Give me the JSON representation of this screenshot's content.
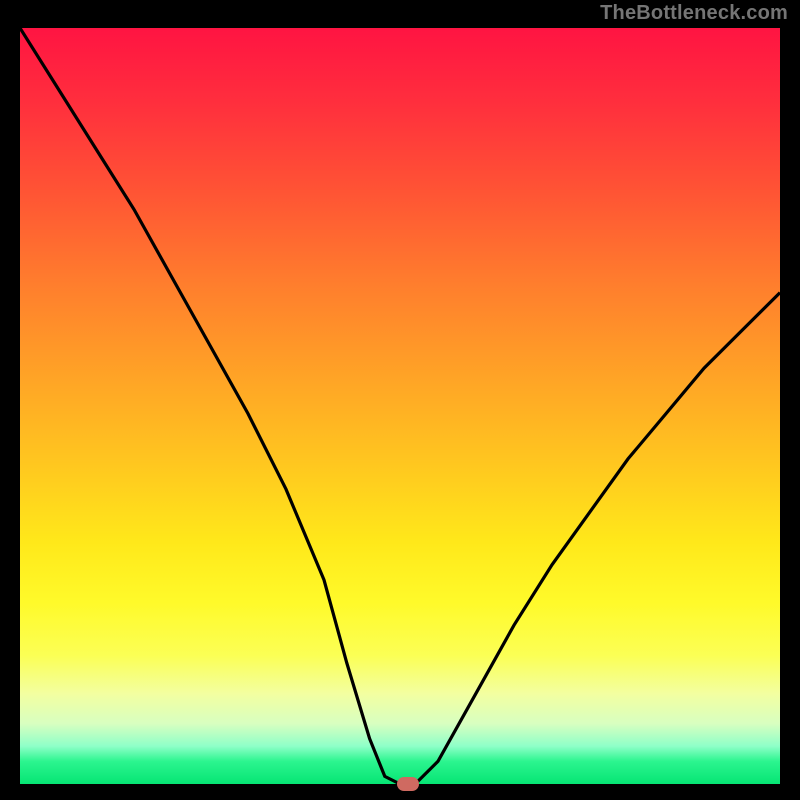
{
  "watermark": "TheBottleneck.com",
  "chart_data": {
    "type": "line",
    "title": "",
    "xlabel": "",
    "ylabel": "",
    "xlim": [
      0,
      100
    ],
    "ylim": [
      0,
      100
    ],
    "x": [
      0,
      5,
      10,
      15,
      20,
      25,
      30,
      35,
      40,
      43,
      46,
      48,
      50,
      52,
      55,
      60,
      65,
      70,
      75,
      80,
      85,
      90,
      95,
      100
    ],
    "values": [
      100,
      92,
      84,
      76,
      67,
      58,
      49,
      39,
      27,
      16,
      6,
      1,
      0,
      0,
      3,
      12,
      21,
      29,
      36,
      43,
      49,
      55,
      60,
      65
    ],
    "marker": {
      "x": 51,
      "y": 0
    },
    "background_gradient": {
      "top": "#ff1442",
      "mid": "#ffe81a",
      "bottom": "#06e574"
    }
  },
  "colors": {
    "frame": "#000000",
    "curve": "#000000",
    "watermark": "#757575",
    "marker": "#cf6a61"
  }
}
